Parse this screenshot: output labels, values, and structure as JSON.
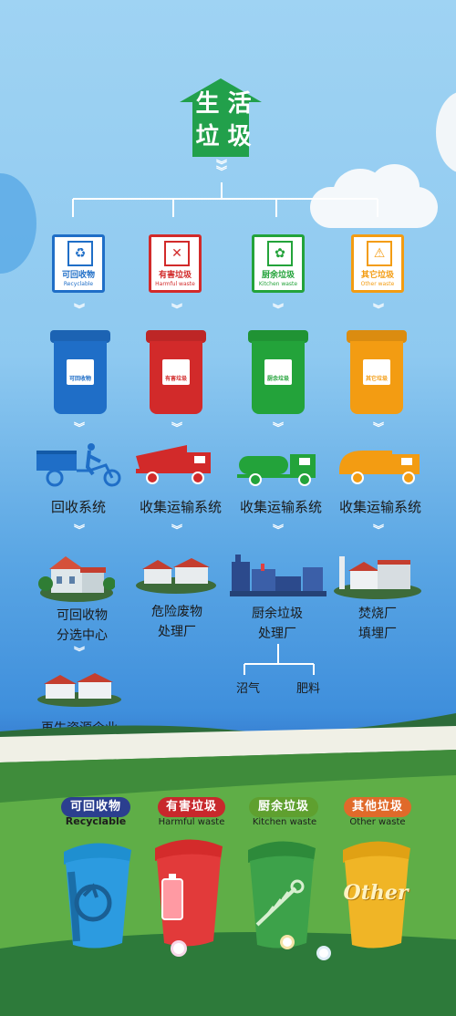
{
  "header": {
    "title_line1": "生 活",
    "title_line2": "垃 圾"
  },
  "colors": {
    "recyclable": "#1f6ec7",
    "harmful": "#d22a2a",
    "kitchen": "#23a33a",
    "other": "#f39c12"
  },
  "categories": [
    {
      "cn": "可回收物",
      "en": "Recyclable"
    },
    {
      "cn": "有害垃圾",
      "en": "Harmful waste"
    },
    {
      "cn": "厨余垃圾",
      "en": "Kitchen waste"
    },
    {
      "cn": "其它垃圾",
      "en": "Other waste"
    }
  ],
  "bin_labels": [
    {
      "cn": "可回收物",
      "en": "Recyclable"
    },
    {
      "cn": "有害垃圾",
      "en": "Harmful waste"
    },
    {
      "cn": "厨余垃圾",
      "en": "Kitchen waste"
    },
    {
      "cn": "其它垃圾",
      "en": "Other waste"
    }
  ],
  "systems": [
    "回收系统",
    "收集运输系统",
    "收集运输系统",
    "收集运输系统"
  ],
  "facilities": [
    {
      "line1": "可回收物",
      "line2": "分选中心"
    },
    {
      "line1": "危险废物",
      "line2": "处理厂"
    },
    {
      "line1": "厨余垃圾",
      "line2": "处理厂"
    },
    {
      "line1": "焚烧厂",
      "line2": "填埋厂"
    }
  ],
  "kitchen_outputs": [
    "沼气",
    "肥料"
  ],
  "final_stage": "再生资源企业",
  "bottom_legend": [
    {
      "cn": "可回收物",
      "en": "Recyclable"
    },
    {
      "cn": "有害垃圾",
      "en": "Harmful waste"
    },
    {
      "cn": "厨余垃圾",
      "en": "Kitchen waste"
    },
    {
      "cn": "其他垃圾",
      "en": "Other  waste"
    }
  ],
  "bottom_bin_text": "Other",
  "icons": [
    "recycle-icon",
    "battery-icon",
    "fishbone-icon",
    "hazard-icon",
    "tree-icon"
  ]
}
